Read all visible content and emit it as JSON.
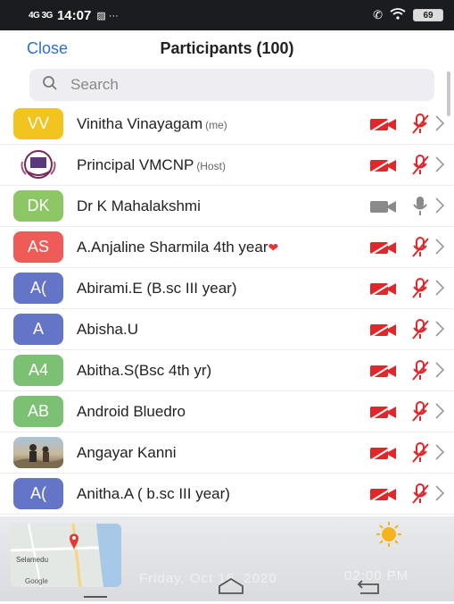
{
  "status": {
    "network": "4G 3G",
    "time": "14:07",
    "battery": "69"
  },
  "header": {
    "close": "Close",
    "title": "Participants (100)"
  },
  "search": {
    "placeholder": "Search"
  },
  "participants": [
    {
      "initials": "VV",
      "name": "Vinitha Vinayagam",
      "tag": "(me)",
      "color": "#f2c41f"
    },
    {
      "initials": "",
      "name": "Principal VMCNP",
      "tag": "(Host)",
      "color": "#ffffff"
    },
    {
      "initials": "DK",
      "name": "Dr K Mahalakshmi",
      "tag": "",
      "color": "#8cc665"
    },
    {
      "initials": "AS",
      "name": "A.Anjaline Sharmila 4th year",
      "tag": "",
      "color": "#ef5c57"
    },
    {
      "initials": "A(",
      "name": "Abirami.E (B.sc III year)",
      "tag": "",
      "color": "#6474c6"
    },
    {
      "initials": "A",
      "name": "Abisha.U",
      "tag": "",
      "color": "#6474c6"
    },
    {
      "initials": "A4",
      "name": "Abitha.S(Bsc 4th yr)",
      "tag": "",
      "color": "#7cc173"
    },
    {
      "initials": "AB",
      "name": "Android Bluedro",
      "tag": "",
      "color": "#7cc173"
    },
    {
      "initials": "",
      "name": "Angayar Kanni",
      "tag": "",
      "color": "#6c5a44"
    },
    {
      "initials": "A(",
      "name": "Anitha.A ( b.sc III year)",
      "tag": "",
      "color": "#6474c6"
    }
  ],
  "notification": {
    "map_place": "Selamedu",
    "map_brand": "Google",
    "date_text": "Friday, Oct 16, 2020",
    "time_text": "02:00 PM"
  },
  "colors": {
    "accent": "#2d6fd1",
    "muted_red": "#e0272b",
    "grey_icon": "#8a8a8a"
  }
}
